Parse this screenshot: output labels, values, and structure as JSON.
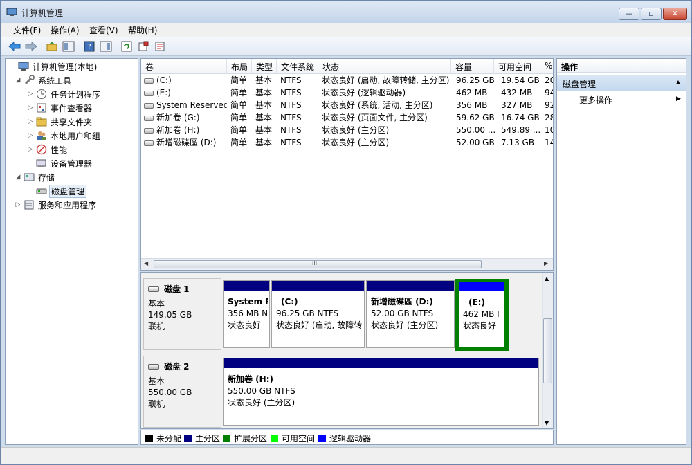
{
  "window": {
    "title": "计算机管理",
    "min_glyph": "—",
    "max_glyph": "▫",
    "close_glyph": "✕"
  },
  "menu": [
    "文件(F)",
    "操作(A)",
    "查看(V)",
    "帮助(H)"
  ],
  "tree": {
    "root": "计算机管理(本地)",
    "system_tools": "系统工具",
    "task_scheduler": "任务计划程序",
    "event_viewer": "事件查看器",
    "shared_folders": "共享文件夹",
    "local_users": "本地用户和组",
    "performance": "性能",
    "device_manager": "设备管理器",
    "storage": "存储",
    "disk_management": "磁盘管理",
    "services_apps": "服务和应用程序"
  },
  "volume_list": {
    "columns": [
      "卷",
      "布局",
      "类型",
      "文件系统",
      "状态",
      "容量",
      "可用空间",
      "%"
    ],
    "rows": [
      [
        "(C:)",
        "简单",
        "基本",
        "NTFS",
        "状态良好 (启动, 故障转储, 主分区)",
        "96.25 GB",
        "19.54 GB",
        "20"
      ],
      [
        "(E:)",
        "简单",
        "基本",
        "NTFS",
        "状态良好 (逻辑驱动器)",
        "462 MB",
        "432 MB",
        "94"
      ],
      [
        "System Reserved",
        "简单",
        "基本",
        "NTFS",
        "状态良好 (系统, 活动, 主分区)",
        "356 MB",
        "327 MB",
        "92"
      ],
      [
        "新加卷 (G:)",
        "简单",
        "基本",
        "NTFS",
        "状态良好 (页面文件, 主分区)",
        "59.62 GB",
        "16.74 GB",
        "28"
      ],
      [
        "新加卷 (H:)",
        "简单",
        "基本",
        "NTFS",
        "状态良好 (主分区)",
        "550.00 ...",
        "549.89 ...",
        "10"
      ],
      [
        "新增磁碟區 (D:)",
        "简单",
        "基本",
        "NTFS",
        "状态良好 (主分区)",
        "52.00 GB",
        "7.13 GB",
        "14"
      ]
    ],
    "hscroll_middle": "III"
  },
  "disks": [
    {
      "name": "磁盘 1",
      "type": "基本",
      "size": "149.05 GB",
      "status": "联机",
      "partitions": [
        {
          "title": "System R",
          "size": "356 MB N",
          "state": "状态良好"
        },
        {
          "title": "(C:)",
          "size": "96.25 GB NTFS",
          "state": "状态良好 (启动, 故障转"
        },
        {
          "title": "新增磁碟區  (D:)",
          "size": "52.00 GB NTFS",
          "state": "状态良好 (主分区)"
        },
        {
          "title": "(E:)",
          "size": "462 MB I",
          "state": "状态良好"
        }
      ]
    },
    {
      "name": "磁盘 2",
      "type": "基本",
      "size": "550.00 GB",
      "status": "联机",
      "partitions": [
        {
          "title": "新加卷  (H:)",
          "size": "550.00 GB NTFS",
          "state": "状态良好 (主分区)"
        }
      ]
    }
  ],
  "legend": [
    {
      "label": "未分配",
      "color": "#000000"
    },
    {
      "label": "主分区",
      "color": "#000080"
    },
    {
      "label": "扩展分区",
      "color": "#008000"
    },
    {
      "label": "可用空间",
      "color": "#00ff00"
    },
    {
      "label": "逻辑驱动器",
      "color": "#0000ff"
    }
  ],
  "actions": {
    "header": "操作",
    "section": "磁盘管理",
    "more": "更多操作"
  }
}
